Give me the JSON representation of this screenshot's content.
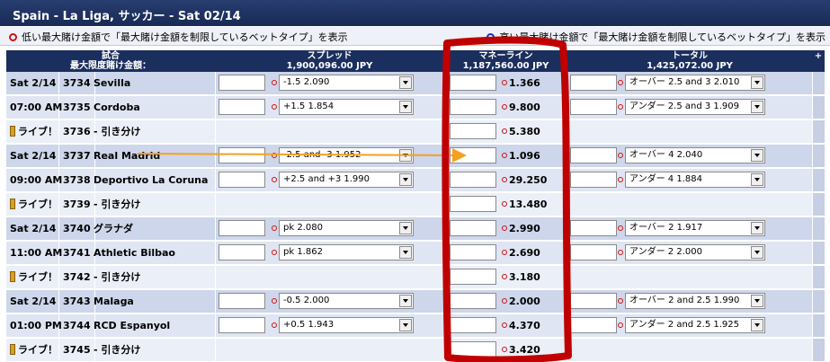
{
  "header": {
    "title": "Spain - La Liga, サッカー - Sat 02/14"
  },
  "notes": {
    "left": "低い最大賭け金額で「最大賭け金額を制限しているベットタイプ」を表示",
    "right": "高い最大賭け金額で「最大賭け金額を制限しているベットタイプ」を表示"
  },
  "columns": {
    "match": "試合",
    "max_bet_label": "最大限度賭け金額：",
    "spread": "スプレッド",
    "spread_max": "1,900,096.00 JPY",
    "moneyline": "マネーライン",
    "moneyline_max": "1,187,560.00 JPY",
    "total": "トータル",
    "total_max": "1,425,072.00 JPY",
    "plus": "+"
  },
  "rows": [
    {
      "date": "Sat 2/14",
      "num": "3734",
      "team": "Sevilla",
      "spread": "-1.5  2.090",
      "ml": "1.366",
      "total": "オーバー 2.5 and 3  2.010"
    },
    {
      "date": "07:00 AM",
      "num": "3735",
      "team": "Cordoba",
      "spread": "+1.5  1.854",
      "ml": "9.800",
      "total": "アンダー 2.5 and 3  1.909"
    },
    {
      "date": "ライブ！",
      "num": "3736",
      "team": "- 引き分け",
      "spread": "",
      "ml": "5.380",
      "total": ""
    },
    {
      "date": "Sat 2/14",
      "num": "3737",
      "team": "Real Madrid",
      "spread": "-2.5 and -3  1.952",
      "ml": "1.096",
      "total": "オーバー 4  2.040"
    },
    {
      "date": "09:00 AM",
      "num": "3738",
      "team": "Deportivo La Coruna",
      "spread": "+2.5 and +3  1.990",
      "ml": "29.250",
      "total": "アンダー 4  1.884"
    },
    {
      "date": "ライブ！",
      "num": "3739",
      "team": "- 引き分け",
      "spread": "",
      "ml": "13.480",
      "total": ""
    },
    {
      "date": "Sat 2/14",
      "num": "3740",
      "team": "グラナダ",
      "spread": "pk  2.080",
      "ml": "2.990",
      "total": "オーバー 2  1.917"
    },
    {
      "date": "11:00 AM",
      "num": "3741",
      "team": "Athletic Bilbao",
      "spread": "pk  1.862",
      "ml": "2.690",
      "total": "アンダー 2  2.000"
    },
    {
      "date": "ライブ！",
      "num": "3742",
      "team": "- 引き分け",
      "spread": "",
      "ml": "3.180",
      "total": ""
    },
    {
      "date": "Sat 2/14",
      "num": "3743",
      "team": "Malaga",
      "spread": "-0.5  2.000",
      "ml": "2.000",
      "total": "オーバー 2 and 2.5  1.990"
    },
    {
      "date": "01:00 PM",
      "num": "3744",
      "team": "RCD Espanyol",
      "spread": "+0.5  1.943",
      "ml": "4.370",
      "total": "アンダー 2 and 2.5  1.925"
    },
    {
      "date": "ライブ！",
      "num": "3745",
      "team": "- 引き分け",
      "spread": "",
      "ml": "3.420",
      "total": ""
    }
  ],
  "colors": {
    "header_bg": "#1b2f5e",
    "row_a": "#cdd6ea",
    "row_b": "#dfe5f2",
    "annotation_red": "#c00000",
    "arrow_orange": "#f5a020"
  },
  "icons": {
    "red_dot": "red-circle-icon",
    "blue_dot": "blue-circle-icon",
    "live": "live-indicator-icon",
    "dropdown": "chevron-down-icon"
  }
}
